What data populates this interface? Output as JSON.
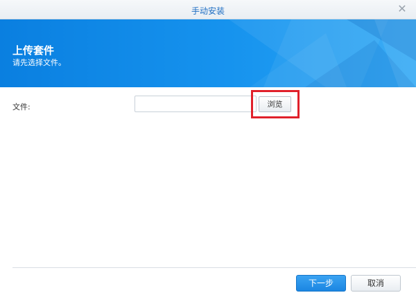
{
  "window": {
    "title": "手动安装",
    "close_symbol": "✕"
  },
  "banner": {
    "title": "上传套件",
    "subtitle": "请先选择文件。"
  },
  "form": {
    "file_label": "文件:",
    "file_value": "",
    "browse_label": "浏览"
  },
  "footer": {
    "next_label": "下一步",
    "cancel_label": "取消"
  },
  "colors": {
    "accent": "#1b86e2",
    "highlight": "#e0202a",
    "title_text": "#1e6ec3"
  }
}
